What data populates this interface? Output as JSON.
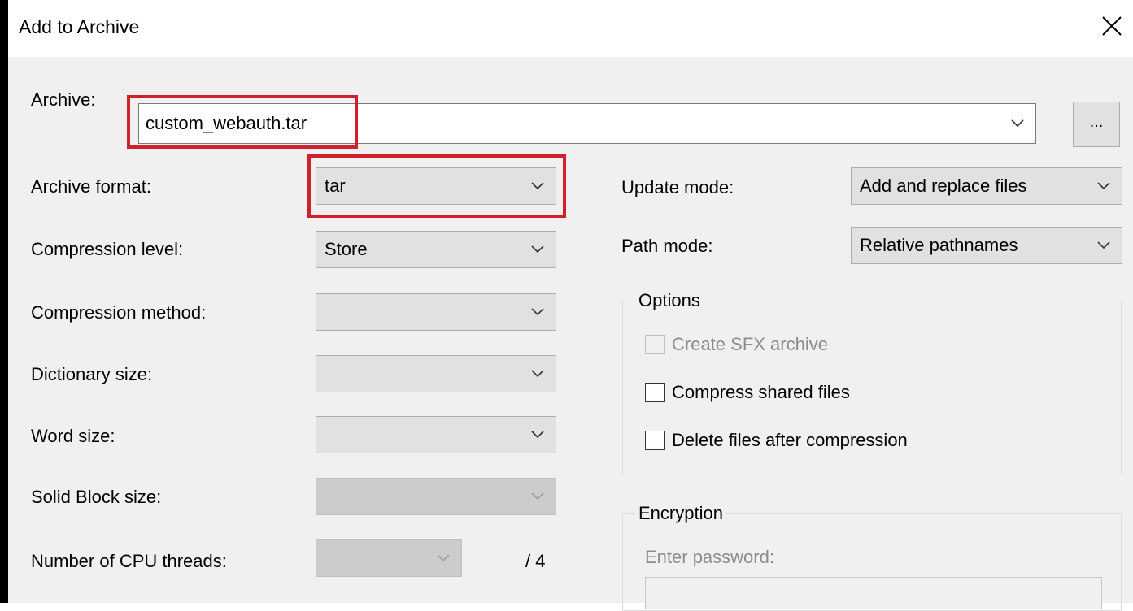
{
  "window": {
    "title": "Add to Archive"
  },
  "archive": {
    "label": "Archive:",
    "value": "custom_webauth.tar",
    "browse_label": "..."
  },
  "left": {
    "archive_format": {
      "label": "Archive format:",
      "value": "tar"
    },
    "compression_level": {
      "label": "Compression level:",
      "value": "Store"
    },
    "compression_method": {
      "label": "Compression method:",
      "value": ""
    },
    "dictionary_size": {
      "label": "Dictionary size:",
      "value": ""
    },
    "word_size": {
      "label": "Word size:",
      "value": ""
    },
    "solid_block_size": {
      "label": "Solid Block size:",
      "value": ""
    },
    "cpu_threads": {
      "label": "Number of CPU threads:",
      "value": "",
      "total": "/ 4"
    }
  },
  "right": {
    "update_mode": {
      "label": "Update mode:",
      "value": "Add and replace files"
    },
    "path_mode": {
      "label": "Path mode:",
      "value": "Relative pathnames"
    },
    "options": {
      "title": "Options",
      "create_sfx": "Create SFX archive",
      "compress_shared": "Compress shared files",
      "delete_after": "Delete files after compression"
    },
    "encryption": {
      "title": "Encryption",
      "password_label": "Enter password:"
    }
  },
  "colors": {
    "highlight": "#d0202b",
    "dialog_bg": "#f0f0f0"
  }
}
